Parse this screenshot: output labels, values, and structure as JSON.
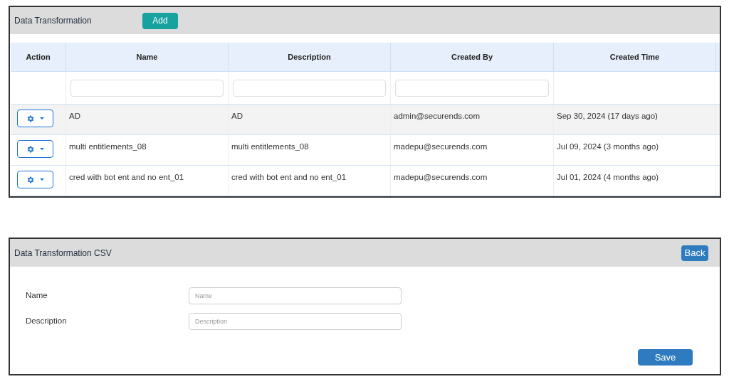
{
  "list_panel": {
    "title": "Data Transformation",
    "add_button": "Add",
    "table": {
      "columns": [
        "Action",
        "Name",
        "Description",
        "Created By",
        "Created Time"
      ],
      "filters": [
        {
          "kind": "text"
        },
        {
          "kind": "text"
        },
        {
          "kind": "text"
        }
      ],
      "rows": [
        {
          "selected": true,
          "name": "AD",
          "description": "AD",
          "created_by": "admin@securends.com",
          "created_time": "Sep 30, 2024 (17 days ago)"
        },
        {
          "selected": false,
          "name": "multi entitlements_08",
          "description": "multi entitlements_08",
          "created_by": "madepu@securends.com",
          "created_time": "Jul 09, 2024 (3 months ago)"
        },
        {
          "selected": false,
          "name": "cred with bot ent and no ent_01",
          "description": "cred with bot ent and no ent_01",
          "created_by": "madepu@securends.com",
          "created_time": "Jul 01, 2024 (4 months ago)"
        }
      ]
    }
  },
  "form_panel": {
    "title": "Data Transformation CSV",
    "back_button": "Back",
    "fields": [
      {
        "label": "Name",
        "placeholder": "Name"
      },
      {
        "label": "Description",
        "placeholder": "Description"
      }
    ],
    "save_button": "Save"
  }
}
